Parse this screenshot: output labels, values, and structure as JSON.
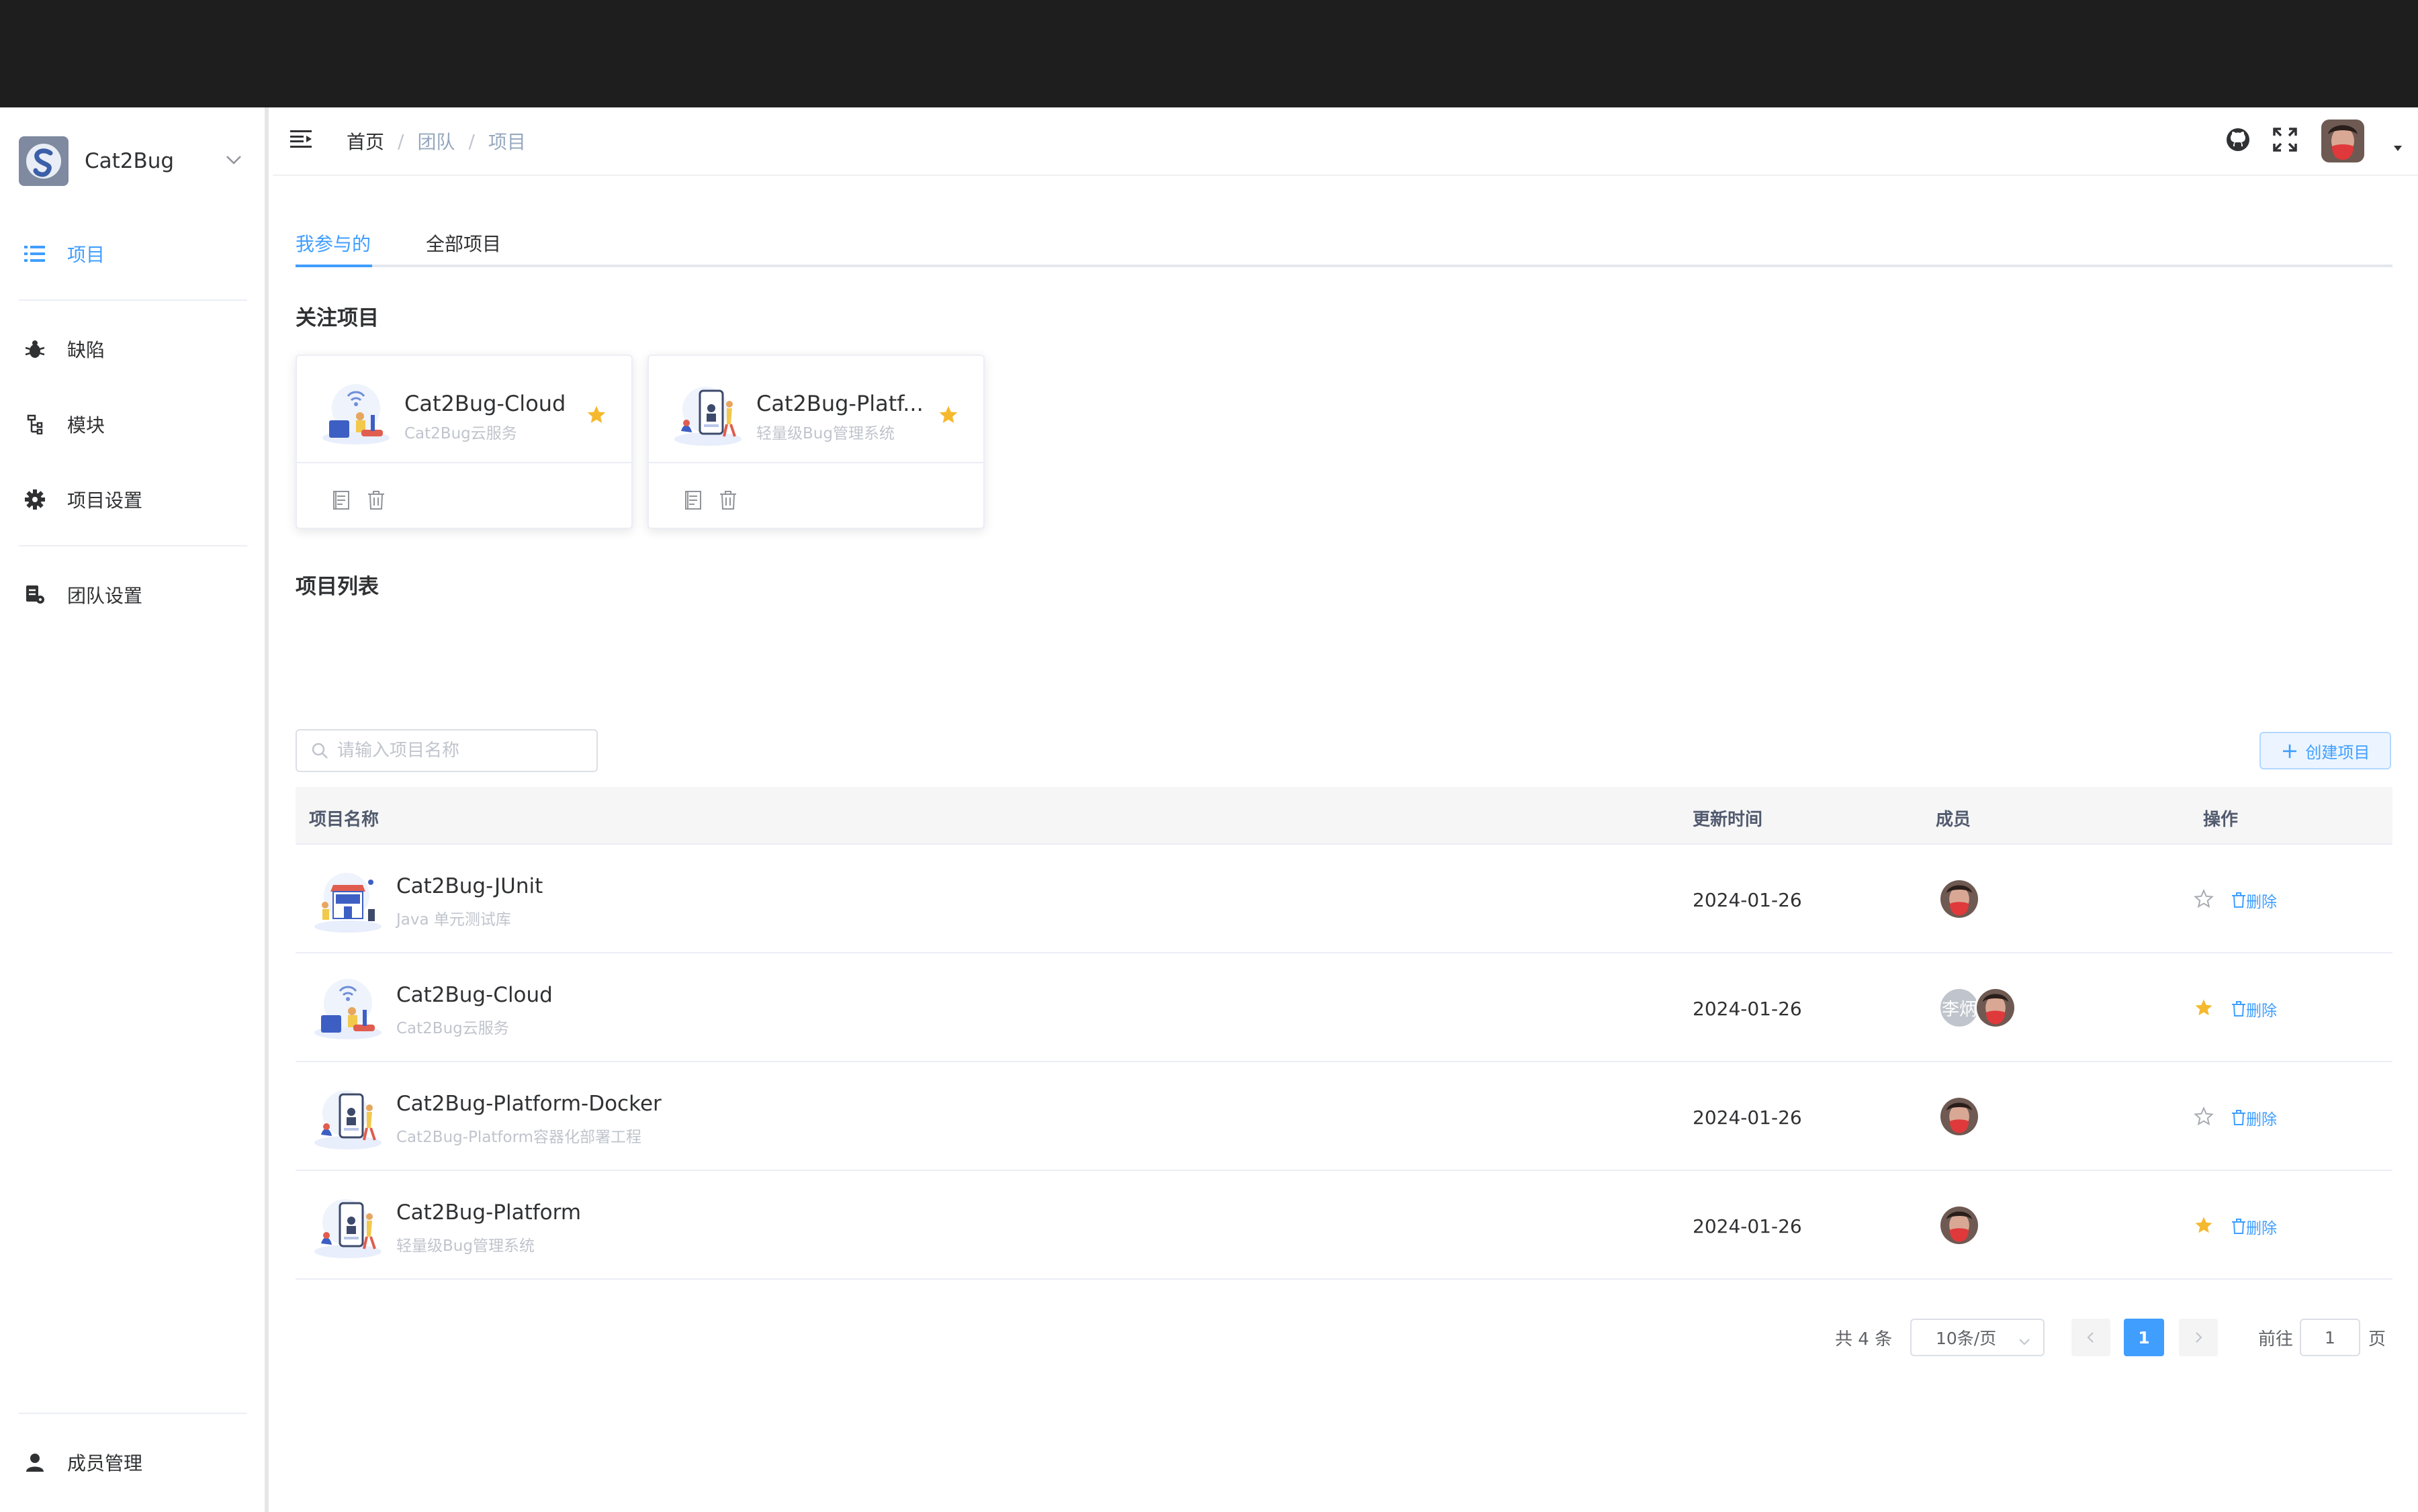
{
  "app": {
    "name": "Cat2Bug"
  },
  "sidebar": {
    "items": [
      {
        "label": "项目",
        "icon": "list-icon"
      },
      {
        "label": "缺陷",
        "icon": "bug-icon"
      },
      {
        "label": "模块",
        "icon": "module-tree-icon"
      },
      {
        "label": "项目设置",
        "icon": "gear-icon"
      },
      {
        "label": "团队设置",
        "icon": "team-settings-icon"
      },
      {
        "label": "成员管理",
        "icon": "user-icon"
      }
    ]
  },
  "breadcrumb": [
    "首页",
    "团队",
    "项目"
  ],
  "tabs": [
    {
      "label": "我参与的"
    },
    {
      "label": "全部项目"
    }
  ],
  "favorites": {
    "title": "关注项目",
    "cards": [
      {
        "title": "Cat2Bug-Cloud",
        "subtitle": "Cat2Bug云服务"
      },
      {
        "title": "Cat2Bug-Platf...",
        "subtitle": "轻量级Bug管理系统"
      }
    ]
  },
  "list": {
    "title": "项目列表",
    "search_placeholder": "请输入项目名称",
    "create_label": "创建项目",
    "columns": [
      "项目名称",
      "更新时间",
      "成员",
      "操作"
    ],
    "delete_label": "删除",
    "rows": [
      {
        "name": "Cat2Bug-JUnit",
        "desc": "Java 单元测试库",
        "date": "2024-01-26",
        "starred": false,
        "members": [
          "photo"
        ]
      },
      {
        "name": "Cat2Bug-Cloud",
        "desc": "Cat2Bug云服务",
        "date": "2024-01-26",
        "starred": true,
        "members": [
          "李炳",
          "photo"
        ]
      },
      {
        "name": "Cat2Bug-Platform-Docker",
        "desc": "Cat2Bug-Platform容器化部署工程",
        "date": "2024-01-26",
        "starred": false,
        "members": [
          "photo"
        ]
      },
      {
        "name": "Cat2Bug-Platform",
        "desc": "轻量级Bug管理系统",
        "date": "2024-01-26",
        "starred": true,
        "members": [
          "photo"
        ]
      }
    ]
  },
  "pagination": {
    "total": "共 4 条",
    "page_size": "10条/页",
    "current": "1",
    "goto_label": "前往",
    "goto_value": "1",
    "unit": "页"
  },
  "colors": {
    "accent": "#409eff",
    "star": "#f5b92f",
    "topbar": "#1e1e1e"
  }
}
